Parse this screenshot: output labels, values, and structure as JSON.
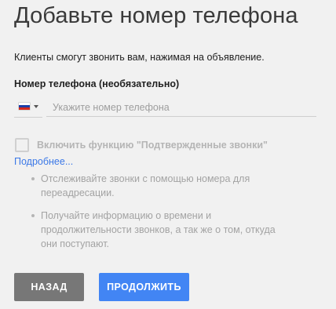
{
  "header": {
    "title": "Добавьте номер телефона",
    "subtitle": "Клиенты смогут звонить вам, нажимая на объявление."
  },
  "phone": {
    "label": "Номер телефона (необязательно)",
    "placeholder": "Укажите номер телефона",
    "value": "",
    "country_flag": "russia-flag-icon"
  },
  "call_verification": {
    "checked": false,
    "label": "Включить функцию \"Подтвержденные звонки\"",
    "more_link": "Подробнее...",
    "bullets": [
      "Отслеживайте звонки с помощью номера для переадресации.",
      "Получайте информацию о времени и продолжительности звонков, а так же о том, откуда они поступают."
    ]
  },
  "actions": {
    "back_label": "НАЗАД",
    "continue_label": "ПРОДОЛЖИТЬ"
  },
  "colors": {
    "background": "#f1f1f1",
    "primary_button": "#4285f4",
    "secondary_button": "#777777",
    "link": "#3b78e7",
    "disabled_text": "#b5b5b5"
  }
}
